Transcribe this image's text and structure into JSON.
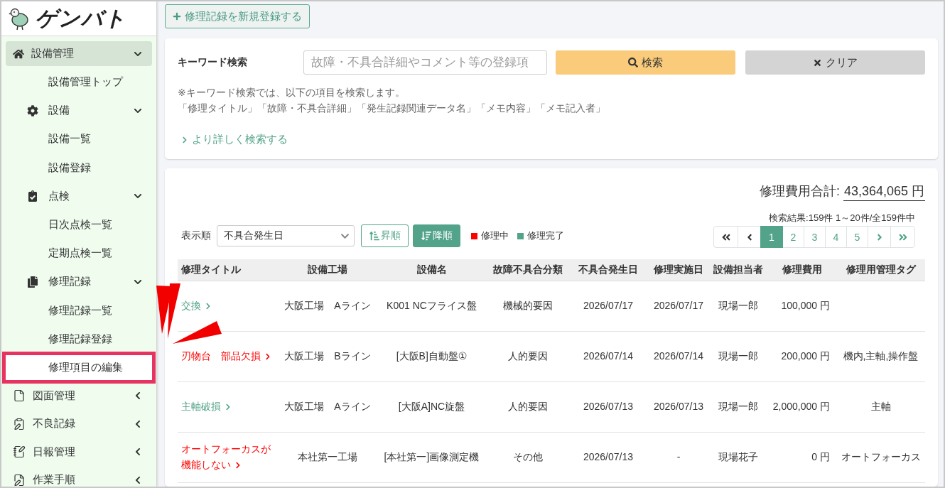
{
  "sidebar": {
    "logo": "ゲンバト",
    "items": [
      {
        "kind": "group",
        "label": "設備管理",
        "selected": true,
        "expanded": true,
        "children": [
          {
            "kind": "link",
            "label": "設備管理トップ",
            "highlighted": false
          },
          {
            "kind": "group",
            "label": "設備",
            "expanded": true,
            "children": [
              {
                "kind": "link",
                "label": "設備一覧",
                "highlighted": false
              },
              {
                "kind": "link",
                "label": "設備登録",
                "highlighted": false
              }
            ]
          },
          {
            "kind": "group",
            "label": "点検",
            "expanded": true,
            "children": [
              {
                "kind": "link",
                "label": "日次点検一覧",
                "highlighted": false
              },
              {
                "kind": "link",
                "label": "定期点検一覧",
                "highlighted": false
              }
            ]
          },
          {
            "kind": "group",
            "label": "修理記録",
            "expanded": true,
            "children": [
              {
                "kind": "link",
                "label": "修理記録一覧",
                "highlighted": false
              },
              {
                "kind": "link",
                "label": "修理記録登録",
                "highlighted": false
              },
              {
                "kind": "link",
                "label": "修理項目の編集",
                "highlighted": true
              }
            ]
          }
        ]
      },
      {
        "kind": "group",
        "label": "図面管理",
        "selected": false,
        "expanded": false
      },
      {
        "kind": "group",
        "label": "不良記録",
        "selected": false,
        "expanded": false
      },
      {
        "kind": "group",
        "label": "日報管理",
        "selected": false,
        "expanded": false
      },
      {
        "kind": "group",
        "label": "作業手順",
        "selected": false,
        "expanded": false
      }
    ]
  },
  "new_record_button": "修理記録を新規登録する",
  "keyword_search": {
    "label": "キーワード検索",
    "placeholder": "故障・不具合詳細やコメント等の登録項",
    "search_button": "検索",
    "clear_button": "クリア",
    "notes": [
      "※キーワード検索では、以下の項目を検索します。",
      "「修理タイトル」「故障・不具合詳細」「発生記録関連データ名」「メモ内容」「メモ記入者」"
    ],
    "advanced_link": "より詳しく検索する"
  },
  "results": {
    "total_label": "修理費用合計:",
    "total": "43,364,065 円",
    "summary": "検索結果:159件 1～20件/全159件中",
    "sort_label": "表示順",
    "sort_field": "不具合発生日",
    "sort_buttons": [
      {
        "kind": "asc",
        "label": "昇順",
        "selected": false
      },
      {
        "kind": "desc",
        "label": "降順",
        "selected": true
      }
    ],
    "legend": [
      {
        "kind": "repairing",
        "label": "修理中",
        "color": "#ff0000"
      },
      {
        "kind": "completed",
        "label": "修理完了",
        "color": "#52a389"
      }
    ],
    "pages": [
      {
        "label": "1",
        "selected": true
      },
      {
        "label": "2",
        "selected": false
      },
      {
        "label": "3",
        "selected": false
      },
      {
        "label": "4",
        "selected": false
      },
      {
        "label": "5",
        "selected": false
      }
    ],
    "table": {
      "columns": [
        "修理タイトル",
        "設備工場",
        "設備名",
        "故障不具合分類",
        "不具合発生日",
        "修理実施日",
        "設備担当者",
        "修理費用",
        "修理用管理タグ"
      ],
      "rows": [
        {
          "repairing": false,
          "title": "交換",
          "factory": "大阪工場　Aライン",
          "equipment": "K001 NCフライス盤",
          "category": "機械的要因",
          "occurred": "2026/07/17",
          "repaired": "2026/07/17",
          "assignee": "現場一郎",
          "cost": "100,000 円"
        },
        {
          "repairing": true,
          "title": "刃物台　部品欠損",
          "factory": "大阪工場　Bライン",
          "equipment": "[大阪B]自動盤①",
          "category": "人的要因",
          "occurred": "2026/07/14",
          "repaired": "2026/07/14",
          "assignee": "現場一郎",
          "cost": "200,000 円",
          "tags": "機内,主軸,操作盤"
        },
        {
          "repairing": false,
          "title": "主軸破損",
          "factory": "大阪工場　Aライン",
          "equipment": "[大阪A]NC旋盤",
          "category": "人的要因",
          "occurred": "2026/07/13",
          "repaired": "2026/07/13",
          "assignee": "現場一郎",
          "cost": "2,000,000 円",
          "tags": "主軸"
        },
        {
          "repairing": true,
          "title": "オートフォーカスが機能しない",
          "factory": "本社第一工場",
          "equipment": "[本社第一]画像測定機",
          "category": "その他",
          "occurred": "2026/07/13",
          "repaired": "-",
          "assignee": "現場花子",
          "cost": "0 円",
          "tags": "オートフォーカス"
        }
      ]
    }
  }
}
